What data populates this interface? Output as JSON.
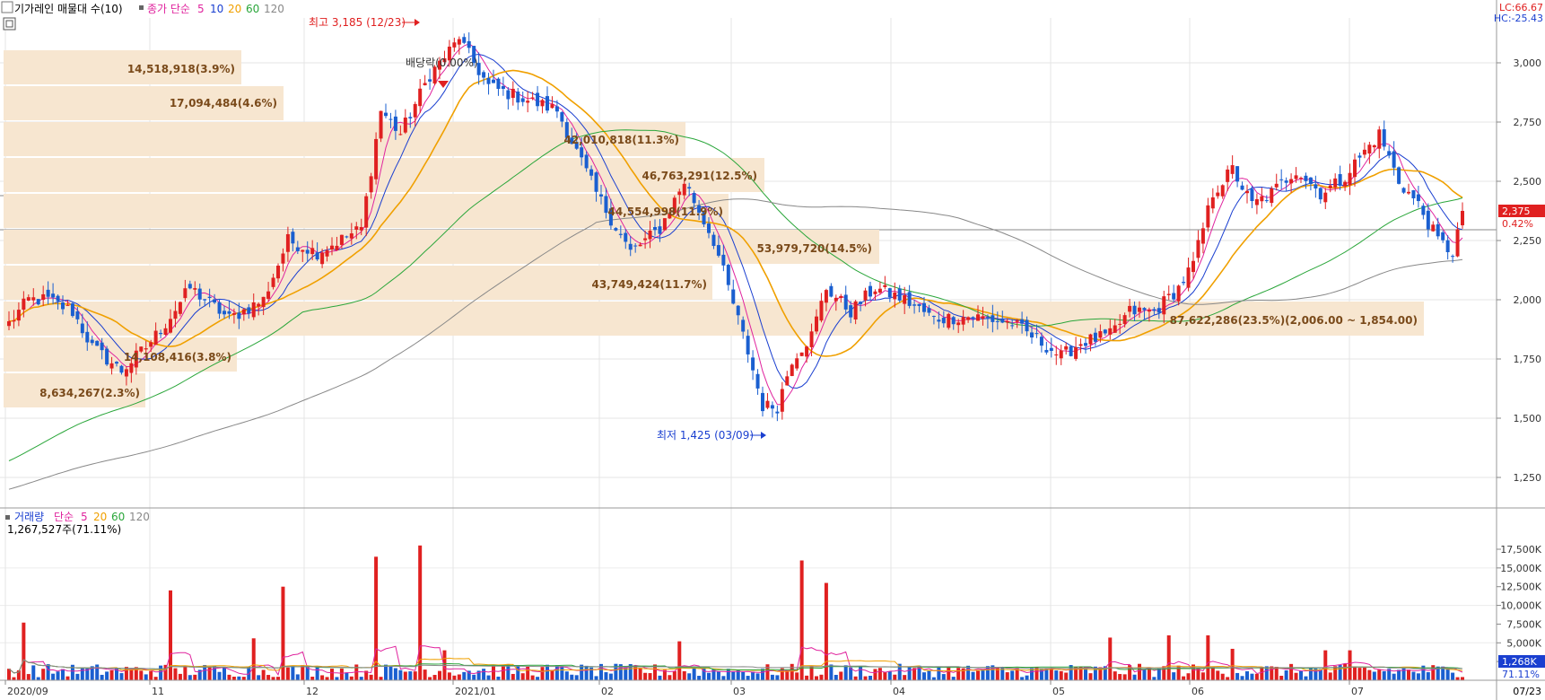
{
  "price_panel": {
    "legend_title": "기가레인 매물대 수(10)",
    "legend_ma_prefix": "종가 단순",
    "ma_periods": [
      {
        "label": "5",
        "color": "#e0249e"
      },
      {
        "label": "10",
        "color": "#1a3fd0"
      },
      {
        "label": "20",
        "color": "#f0a000"
      },
      {
        "label": "60",
        "color": "#2aa63a"
      },
      {
        "label": "120",
        "color": "#888888"
      }
    ],
    "lc_label": "LC:66.67",
    "hc_label": "HC:-25.43",
    "high_annotation": "최고 3,185 (12/23)",
    "low_annotation": "최저 1,425 (03/09)",
    "dividend_label": "배당락(0.00%)",
    "current_price": "2,375",
    "current_change": "0.42%",
    "y_ticks": [
      "3,000",
      "2,750",
      "2,500",
      "2,250",
      "2,000",
      "1,750",
      "1,500",
      "1,250"
    ]
  },
  "volume_panel": {
    "legend_title": "거래량",
    "legend_ma_prefix": "단순",
    "ma_periods": [
      "5",
      "20",
      "60",
      "120"
    ],
    "info": "1,267,527주(71.11%)",
    "current_volume": "1,268K",
    "current_ratio": "71.11%",
    "y_ticks": [
      "17,500K",
      "15,000K",
      "12,500K",
      "10,000K",
      "7,500K",
      "5,000K",
      "2,500K"
    ]
  },
  "x_axis": {
    "labels": [
      "2020/09",
      "11",
      "12",
      "2021/01",
      "02",
      "03",
      "04",
      "05",
      "06",
      "07"
    ],
    "last_date": "07/23"
  },
  "chart_data": {
    "type": "candlestick",
    "units": {
      "price": "KRW",
      "volume": "shares (K)"
    },
    "price_ylim": [
      1100,
      3200
    ],
    "volume_ylim": [
      0,
      19000
    ],
    "overall_high": {
      "value": 3185,
      "date": "12/23"
    },
    "overall_low": {
      "value": 1425,
      "date": "03/09"
    },
    "volume_profile": {
      "n_zones": 10,
      "zones": [
        {
          "label": "14,518,918(3.9%)",
          "low": 2950,
          "high": 3100,
          "share": 3.9
        },
        {
          "label": "17,094,484(4.6%)",
          "low": 2800,
          "high": 2950,
          "share": 4.6
        },
        {
          "label": "42,010,818(11.3%)",
          "low": 2500,
          "high": 2800,
          "share": 11.3
        },
        {
          "label": "46,763,291(12.5%)",
          "low": 2450,
          "high": 2600,
          "share": 12.5
        },
        {
          "label": "44,554,998(11.9%)",
          "low": 2300,
          "high": 2450,
          "share": 11.9
        },
        {
          "label": "53,979,720(14.5%)",
          "low": 2150,
          "high": 2300,
          "share": 14.5
        },
        {
          "label": "43,749,424(11.7%)",
          "low": 2000,
          "high": 2150,
          "share": 11.7
        },
        {
          "label": "87,622,286(23.5%)(2,006.00 ~ 1,854.00)",
          "low": 1854,
          "high": 2006,
          "share": 23.5
        },
        {
          "label": "14,108,416(3.8%)",
          "low": 1700,
          "high": 1854,
          "share": 3.8
        },
        {
          "label": "8,634,267(2.3%)",
          "low": 1550,
          "high": 1700,
          "share": 2.3
        }
      ]
    },
    "anchors": [
      {
        "i": 0,
        "c": 1900
      },
      {
        "i": 4,
        "c": 2000
      },
      {
        "i": 8,
        "c": 2000
      },
      {
        "i": 13,
        "c": 1950
      },
      {
        "i": 17,
        "c": 1800
      },
      {
        "i": 23,
        "c": 1700
      },
      {
        "i": 28,
        "c": 1800
      },
      {
        "i": 32,
        "c": 1900
      },
      {
        "i": 37,
        "c": 2050
      },
      {
        "i": 45,
        "c": 1920
      },
      {
        "i": 52,
        "c": 2000
      },
      {
        "i": 57,
        "c": 2250
      },
      {
        "i": 63,
        "c": 2200
      },
      {
        "i": 72,
        "c": 2300
      },
      {
        "i": 76,
        "c": 2800
      },
      {
        "i": 80,
        "c": 2700
      },
      {
        "i": 86,
        "c": 2950
      },
      {
        "i": 92,
        "c": 3100
      },
      {
        "i": 98,
        "c": 2900
      },
      {
        "i": 105,
        "c": 2850
      },
      {
        "i": 112,
        "c": 2800
      },
      {
        "i": 120,
        "c": 2450
      },
      {
        "i": 127,
        "c": 2200
      },
      {
        "i": 133,
        "c": 2300
      },
      {
        "i": 138,
        "c": 2500
      },
      {
        "i": 144,
        "c": 2250
      },
      {
        "i": 147,
        "c": 2050
      },
      {
        "i": 151,
        "c": 1780
      },
      {
        "i": 154,
        "c": 1550
      },
      {
        "i": 157,
        "c": 1550
      },
      {
        "i": 160,
        "c": 1750
      },
      {
        "i": 164,
        "c": 1850
      },
      {
        "i": 167,
        "c": 2050
      },
      {
        "i": 172,
        "c": 1950
      },
      {
        "i": 177,
        "c": 2050
      },
      {
        "i": 183,
        "c": 2000
      },
      {
        "i": 189,
        "c": 1920
      },
      {
        "i": 197,
        "c": 1930
      },
      {
        "i": 205,
        "c": 1900
      },
      {
        "i": 211,
        "c": 1820
      },
      {
        "i": 215,
        "c": 1760
      },
      {
        "i": 219,
        "c": 1820
      },
      {
        "i": 225,
        "c": 1850
      },
      {
        "i": 229,
        "c": 1950
      },
      {
        "i": 234,
        "c": 1950
      },
      {
        "i": 239,
        "c": 2050
      },
      {
        "i": 242,
        "c": 2150
      },
      {
        "i": 246,
        "c": 2450
      },
      {
        "i": 250,
        "c": 2550
      },
      {
        "i": 254,
        "c": 2400
      },
      {
        "i": 258,
        "c": 2450
      },
      {
        "i": 263,
        "c": 2550
      },
      {
        "i": 268,
        "c": 2450
      },
      {
        "i": 272,
        "c": 2500
      },
      {
        "i": 276,
        "c": 2600
      },
      {
        "i": 280,
        "c": 2700
      },
      {
        "i": 284,
        "c": 2500
      },
      {
        "i": 288,
        "c": 2400
      },
      {
        "i": 292,
        "c": 2250
      },
      {
        "i": 295,
        "c": 2200
      },
      {
        "i": 297,
        "c": 2375
      }
    ],
    "n_candles": 298,
    "volume_spikes": [
      {
        "i": 3,
        "v": 7700
      },
      {
        "i": 33,
        "v": 12000
      },
      {
        "i": 50,
        "v": 5600
      },
      {
        "i": 56,
        "v": 12500
      },
      {
        "i": 75,
        "v": 16500
      },
      {
        "i": 84,
        "v": 18000
      },
      {
        "i": 89,
        "v": 4000
      },
      {
        "i": 137,
        "v": 5200
      },
      {
        "i": 162,
        "v": 16000
      },
      {
        "i": 167,
        "v": 13000
      },
      {
        "i": 225,
        "v": 5700
      },
      {
        "i": 237,
        "v": 6000
      },
      {
        "i": 245,
        "v": 6000
      },
      {
        "i": 250,
        "v": 4200
      },
      {
        "i": 269,
        "v": 4000
      },
      {
        "i": 274,
        "v": 4000
      }
    ]
  }
}
